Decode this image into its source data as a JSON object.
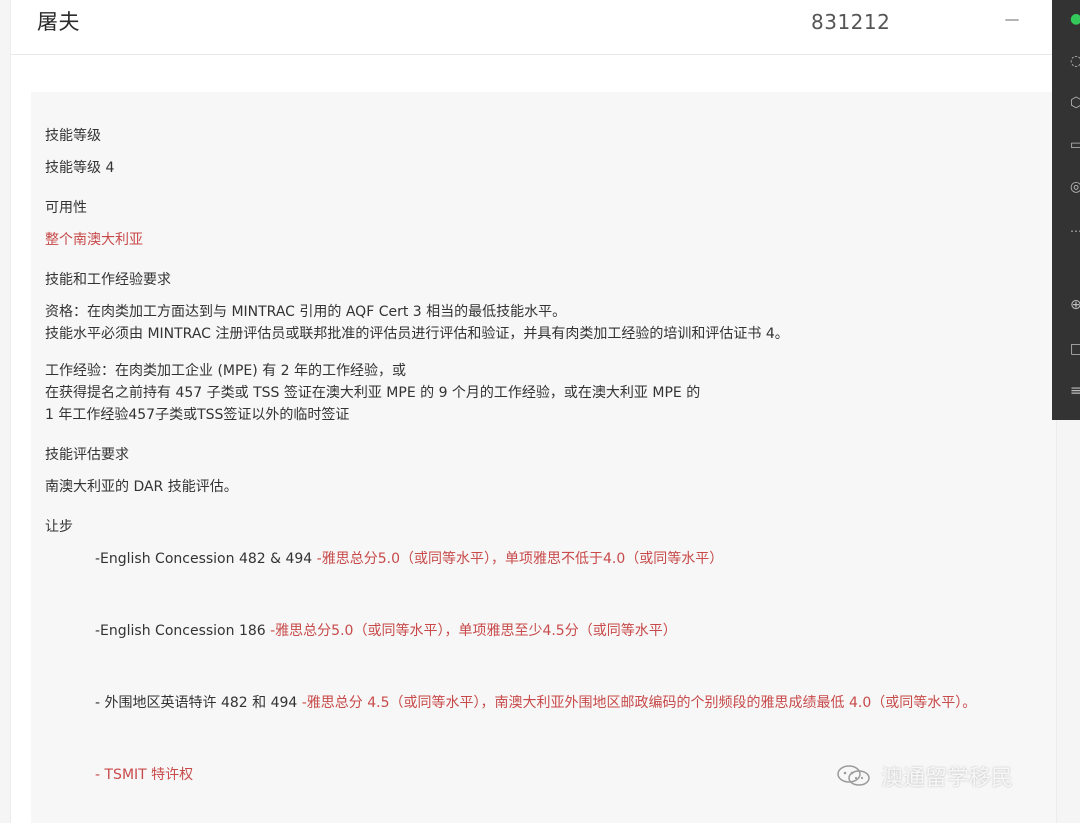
{
  "header": {
    "title": "屠夫",
    "code": "831212"
  },
  "content": {
    "skill_level_title": "技能等级",
    "skill_level_value": "技能等级 4",
    "availability_title": "可用性",
    "availability_value": "整个南澳大利亚",
    "skills_experience_title": "技能和工作经验要求",
    "qualification_line_1": "资格：在肉类加工方面达到与 MINTRAC 引用的 AQF Cert 3 相当的最低技能水平。",
    "qualification_line_2": "技能水平必须由 MINTRAC 注册评估员或联邦批准的评估员进行评估和验证，并具有肉类加工经验的培训和评估证书 4。",
    "work_experience_line_1": "工作经验：在肉类加工企业 (MPE) 有 2 年的工作经验，或",
    "work_experience_line_2": "在获得提名之前持有 457 子类或 TSS 签证在澳大利亚 MPE 的 9 个月的工作经验，或在澳大利亚 MPE 的",
    "work_experience_line_3": "1 年工作经验457子类或TSS签证以外的临时签证",
    "assessment_title": "技能评估要求",
    "assessment_value": "南澳大利亚的 DAR 技能评估。",
    "concessions_title": "让步",
    "concessions": [
      {
        "prefix": "-English Concession 482 & 494 ",
        "detail": "-雅思总分5.0（或同等水平），单项雅思不低于4.0（或同等水平）"
      },
      {
        "prefix": "-English Concession 186 ",
        "detail": "-雅思总分5.0（或同等水平），单项雅思至少4.5分（或同等水平）"
      },
      {
        "prefix": "- 外围地区英语特许 482 和 494 ",
        "detail": "-雅思总分 4.5（或同等水平），南澳大利亚外围地区邮政编码的个别频段的雅思成绩最低 4.0（或同等水平）。"
      },
      {
        "prefix": "",
        "detail": "- TSMIT 特许权"
      }
    ]
  },
  "watermark": {
    "text": "澳通留学移民"
  },
  "colors": {
    "accent_red": "#c84a4a",
    "panel_bg": "#f7f7f7",
    "rail_bg": "#333333",
    "wechat_green": "#34c759"
  },
  "icons": {
    "collapse": "minus-icon",
    "wechat": "wechat-icon",
    "rail": [
      "chat-icon",
      "user-icon",
      "cube-icon",
      "folder-icon",
      "aperture-icon",
      "more-icon",
      "link-icon",
      "square-icon",
      "menu-icon"
    ]
  }
}
